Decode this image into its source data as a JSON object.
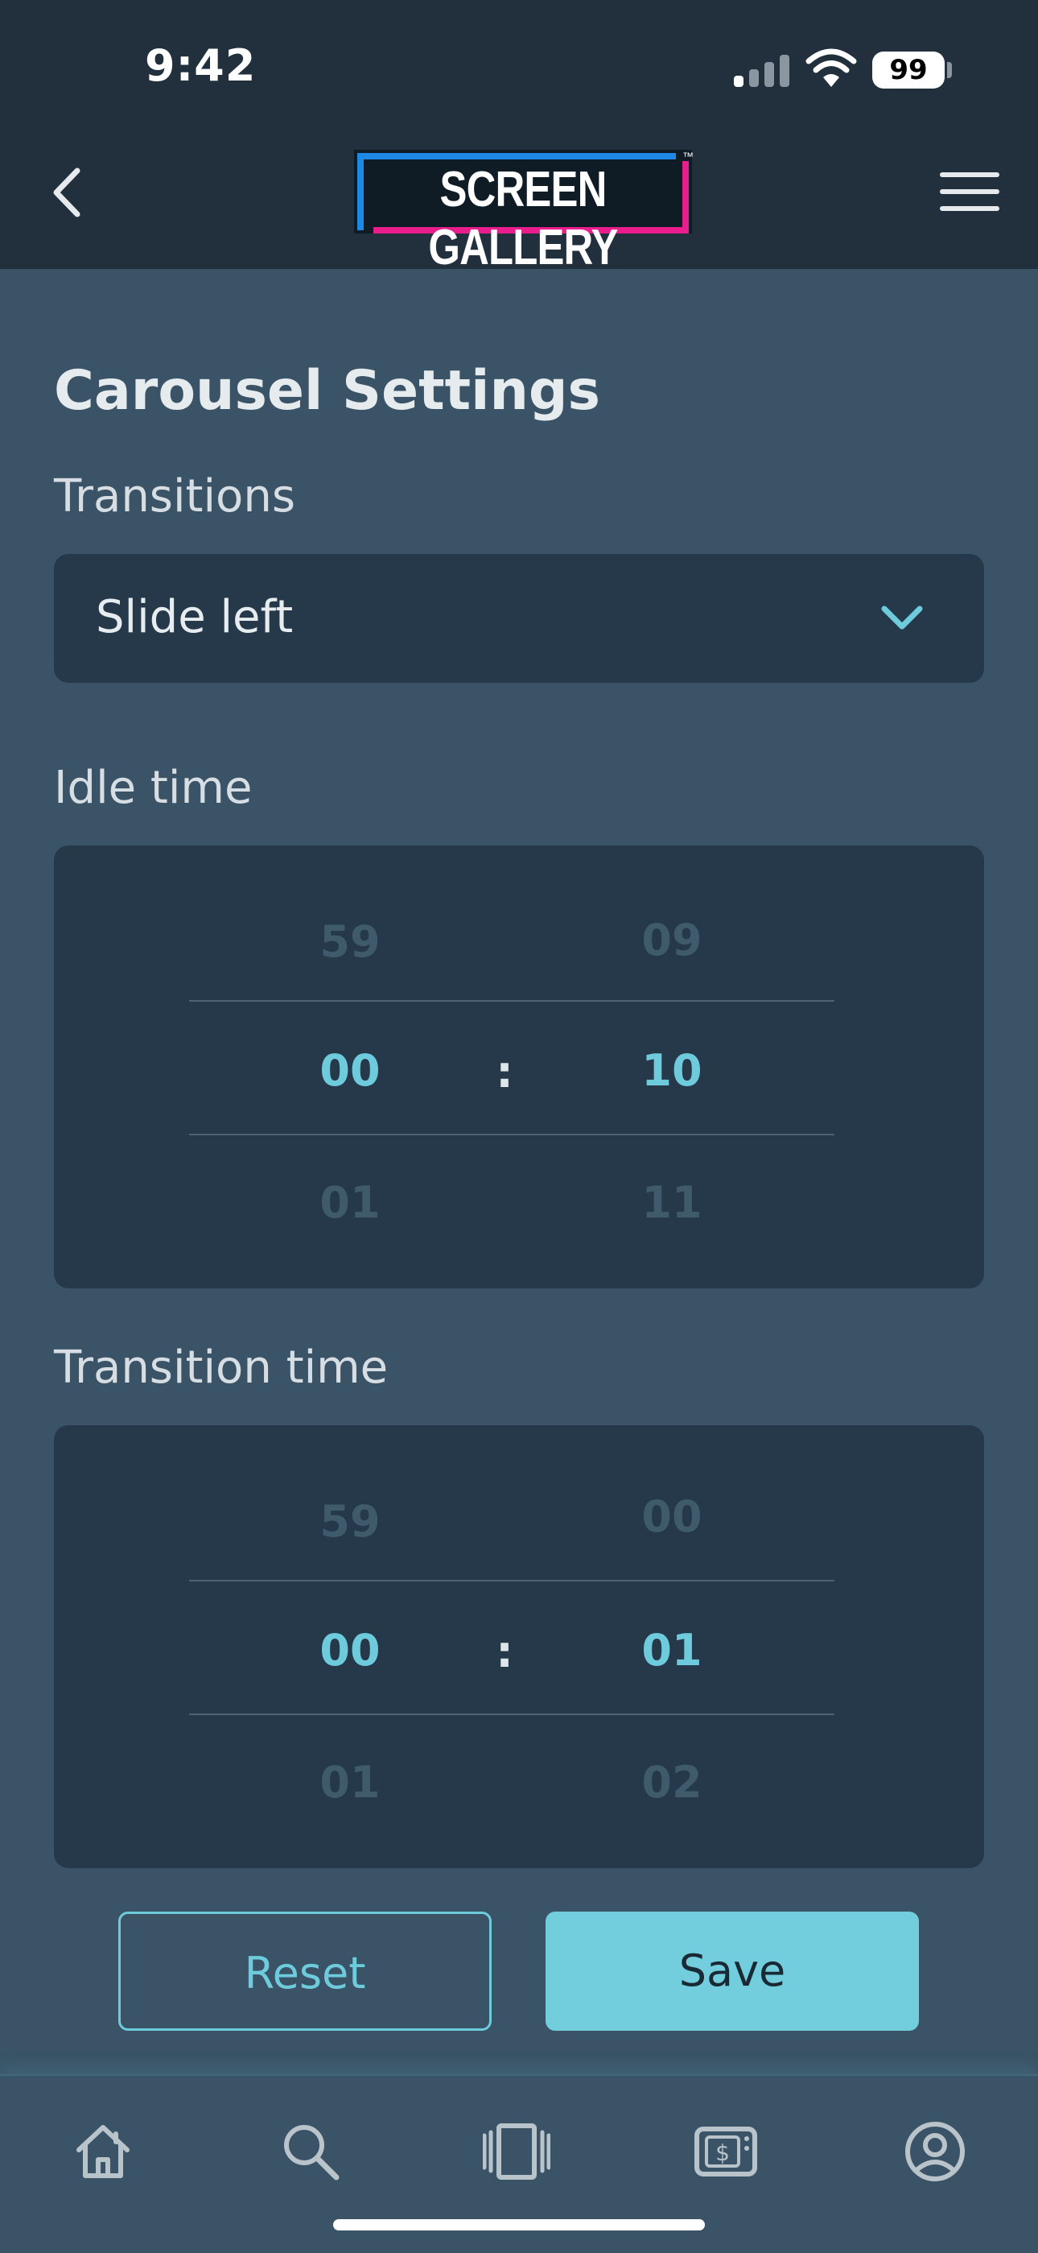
{
  "status_bar": {
    "time": "9:42",
    "battery": "99"
  },
  "header": {
    "logo_text": "SCREEN GALLERY",
    "logo_tm": "™"
  },
  "page": {
    "title": "Carousel Settings"
  },
  "transitions": {
    "label": "Transitions",
    "selected": "Slide left"
  },
  "idle_time": {
    "label": "Idle time",
    "minutes": {
      "prev": "59",
      "current": "00",
      "next": "01"
    },
    "seconds": {
      "prev": "09",
      "current": "10",
      "next": "11"
    },
    "separator": ":"
  },
  "transition_time": {
    "label": "Transition time",
    "minutes": {
      "prev": "59",
      "current": "00",
      "next": "01"
    },
    "seconds": {
      "prev": "00",
      "current": "01",
      "next": "02"
    },
    "separator": ":"
  },
  "actions": {
    "reset_label": "Reset",
    "save_label": "Save"
  },
  "tabbar": {
    "items": [
      {
        "icon": "home-icon"
      },
      {
        "icon": "search-icon"
      },
      {
        "icon": "carousel-icon"
      },
      {
        "icon": "pricing-icon"
      },
      {
        "icon": "profile-icon"
      }
    ]
  },
  "colors": {
    "header_bg": "#21303c",
    "page_bg": "#3a5366",
    "panel_bg": "#25394a",
    "accent": "#6ecbdc",
    "logo_blue": "#1e88e5",
    "logo_pink": "#e91e8c"
  }
}
